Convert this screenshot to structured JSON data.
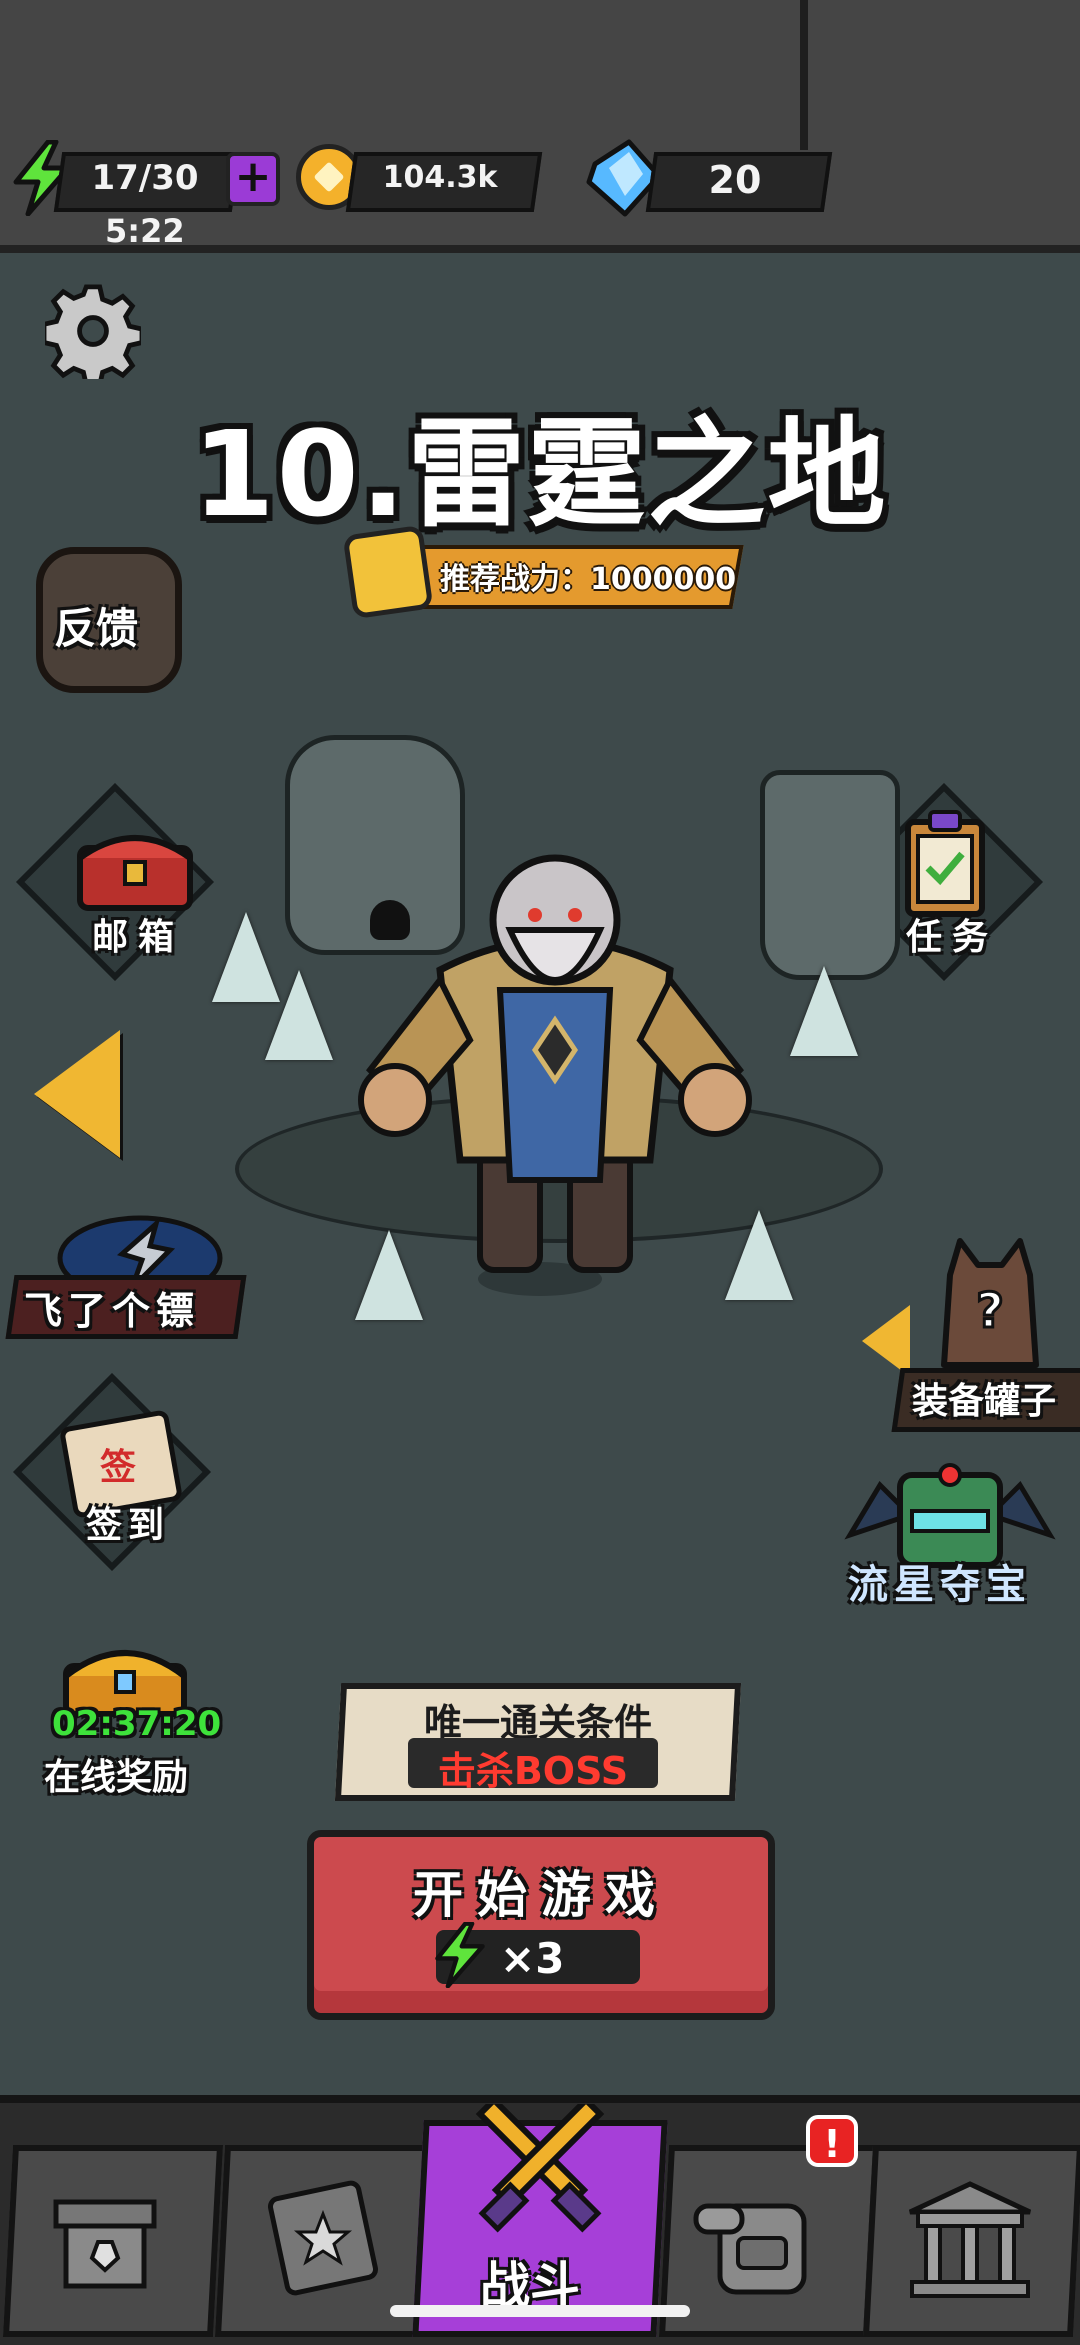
{
  "top_bar": {
    "energy": "17/30",
    "energy_timer": "5:22",
    "gold": "104.3k",
    "gems": "20"
  },
  "stage": {
    "title": "10.雷霆之地",
    "recommended_power": "推荐战力：1000000"
  },
  "side_menu": {
    "feedback": "反馈",
    "mailbox": "邮箱",
    "tasks": "任务",
    "fly_dart": "飞了个镖",
    "sign_in": "签到",
    "sign_icon_text": "签",
    "equipment_jar": "装备罐子",
    "meteor_treasure": "流星夺宝",
    "online_reward": "在线奖励",
    "online_timer": "02:37:20"
  },
  "condition": {
    "title": "唯一通关条件",
    "requirement": "击杀BOSS"
  },
  "start_button": {
    "label": "开始游戏",
    "cost": "×3"
  },
  "bottom_nav": {
    "battle": "战斗",
    "badge": "!"
  },
  "colors": {
    "background": "#3e4a4b",
    "accent_purple": "#a63fd8",
    "start_red": "#cc4a4e",
    "gold": "#f0b732"
  }
}
